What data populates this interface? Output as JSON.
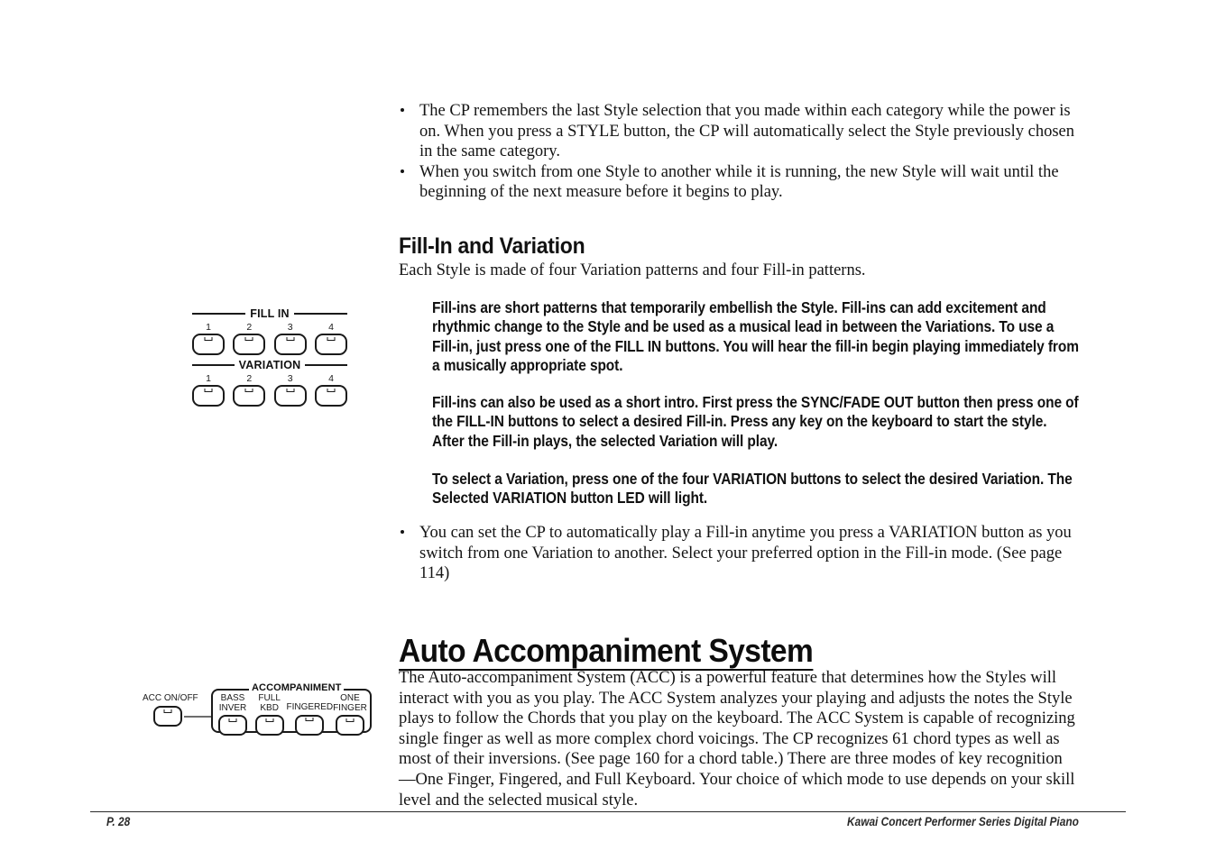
{
  "document": {
    "footer": {
      "page_label": "P. 28",
      "product_line": "Kawai Concert Performer Series Digital Piano"
    }
  },
  "top_bullets": [
    "The CP remembers the last Style selection that you made within each category while the power is on. When you press a STYLE button, the CP will automatically select the Style previously chosen in the same category.",
    "When you switch from one Style to another while it is running, the new Style will wait until the beginning of the next measure before it begins to play."
  ],
  "fill_in_section": {
    "heading": "Fill-In and Variation",
    "intro": "Each Style is made of four Variation patterns and four Fill-in patterns.",
    "callouts": [
      "Fill-ins are short patterns that temporarily embellish the Style.  Fill-ins can add excitement and rhythmic change to the Style and be used as a musical lead in between the Variations.  To use a Fill-in, just press one of the FILL IN buttons.  You will hear the fill-in begin playing immediately from a musically appropriate spot.",
      "Fill-ins can also be used as a short intro.  First press the SYNC/FADE OUT button then press one of the FILL-IN buttons to select a desired Fill-in.  Press any key on the keyboard to start the style.  After the Fill-in plays, the selected Variation will play.",
      "To select a Variation, press one of the four VARIATION buttons to select the desired Variation.  The Selected VARIATION button LED will light."
    ],
    "closing_bullet": "You can set the CP to automatically play a Fill-in anytime you press a VARIATION button as you switch from one Variation to another. Select your preferred option in the Fill-in mode. (See page 114)"
  },
  "fill_in_panel": {
    "fill_in_group_label": "FILL IN",
    "variation_group_label": "VARIATION",
    "fill_in_buttons": [
      "1",
      "2",
      "3",
      "4"
    ],
    "variation_buttons": [
      "1",
      "2",
      "3",
      "4"
    ]
  },
  "acc_section": {
    "heading": "Auto Accompaniment System",
    "body": "The Auto-accompaniment System (ACC) is a powerful feature that determines how the Styles will interact with you as you play.  The ACC System analyzes your playing and adjusts the notes the Style plays to follow the Chords that you play on the keyboard.  The ACC System is capable of recognizing single finger as well as more complex chord voicings.  The CP recognizes 61 chord types as well as most of their inversions. (See page 160 for a chord table.) There are three modes of key recognition—One Finger, Fingered, and Full Keyboard.  Your choice of which mode to use depends on your skill level and the selected musical style."
  },
  "acc_panel": {
    "on_off_label": "ACC  ON/OFF",
    "group_label": "ACCOMPANIMENT",
    "buttons": [
      "BASS\nINVER",
      "FULL\nKBD",
      "FINGERED",
      "ONE\nFINGER"
    ]
  }
}
